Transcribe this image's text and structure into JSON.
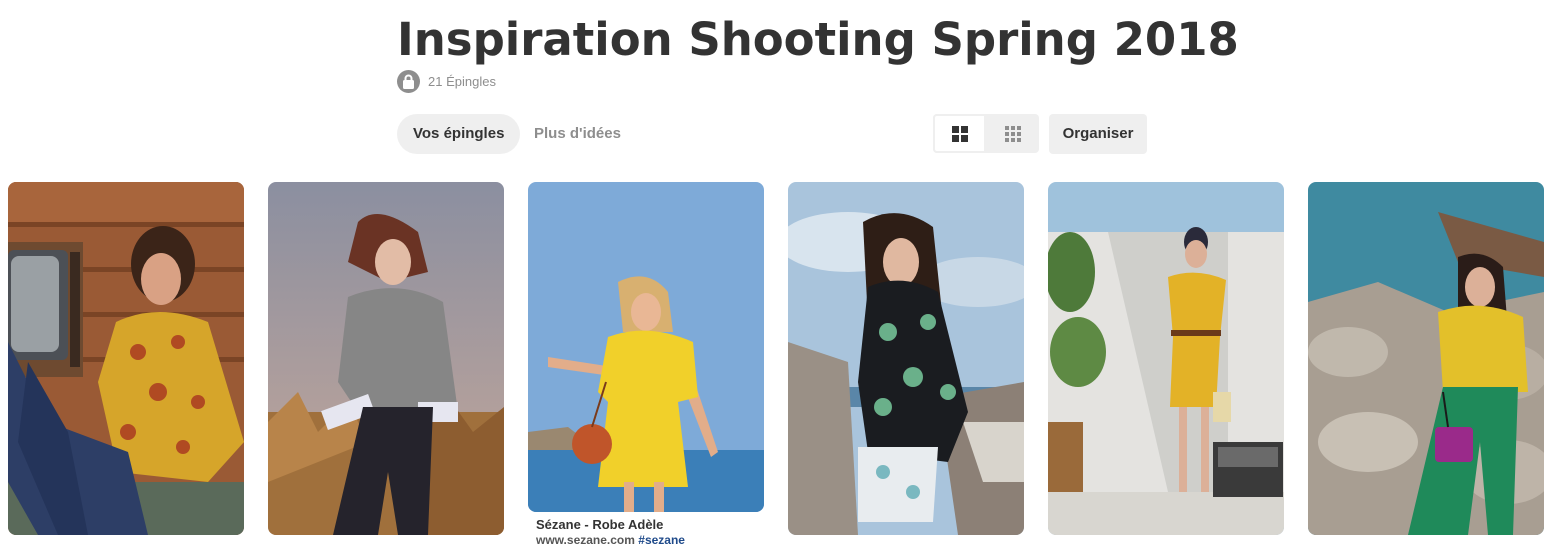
{
  "board": {
    "title": "Inspiration Shooting Spring 2018",
    "pin_count": "21 Épingles"
  },
  "tabs": {
    "your_pins": "Vos épingles",
    "more_ideas": "Plus d'idées"
  },
  "toolbar": {
    "organize_label": "Organiser"
  },
  "pins": [
    {
      "caption": "",
      "icon": "photo-woman-yellow-floral-blouse"
    },
    {
      "caption": "",
      "icon": "photo-woman-grey-sweater-field"
    },
    {
      "caption": "Sézane - Robe Adèle",
      "subline_text": "www.sezane.com ",
      "subline_tag": "#sezane",
      "icon": "photo-woman-yellow-dress-beach"
    },
    {
      "caption": "",
      "icon": "photo-woman-black-floral-jacket"
    },
    {
      "caption": "",
      "icon": "photo-woman-yellow-dress-wall"
    },
    {
      "caption": "",
      "icon": "photo-woman-yellow-top-rocks"
    }
  ]
}
